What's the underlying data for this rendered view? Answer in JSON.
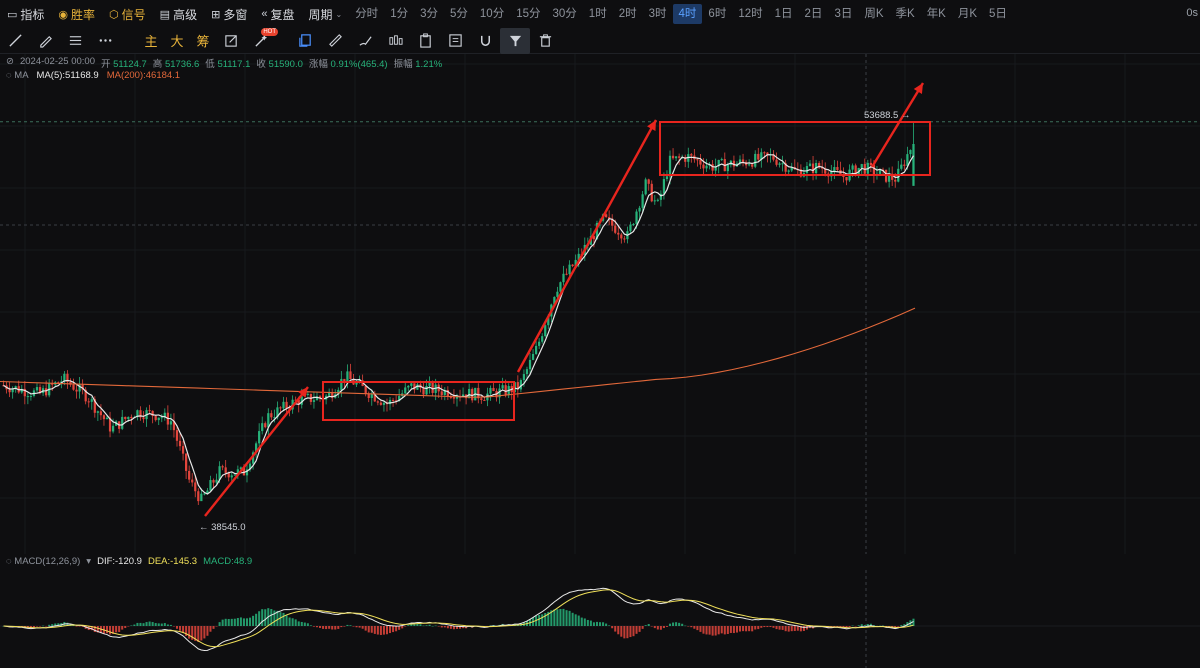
{
  "toolbar": {
    "items": [
      {
        "label": "指标",
        "icon": "indicator-icon",
        "gold": false
      },
      {
        "label": "胜率",
        "icon": "winrate-icon",
        "gold": true
      },
      {
        "label": "信号",
        "icon": "signal-icon",
        "gold": true
      },
      {
        "label": "高级",
        "icon": "advanced-icon",
        "gold": false
      },
      {
        "label": "多窗",
        "icon": "multiwindow-icon",
        "gold": false
      },
      {
        "label": "复盘",
        "icon": "replay-icon",
        "gold": false
      },
      {
        "label": "周期",
        "icon": "chevron-down-icon",
        "gold": false
      }
    ],
    "periods": [
      "分时",
      "1分",
      "3分",
      "5分",
      "10分",
      "15分",
      "30分",
      "1时",
      "2时",
      "3时",
      "4时",
      "6时",
      "12时",
      "1日",
      "2日",
      "3日",
      "周K",
      "季K",
      "年K",
      "月K",
      "5日"
    ],
    "active_period": "4时",
    "right_edge": "0s"
  },
  "drawing_tools": {
    "text_tools": [
      "主",
      "大",
      "筹"
    ],
    "hot_badge": "HOT"
  },
  "ohlc": {
    "date": "2024-02-25 00:00",
    "open_label": "开",
    "open": "51124.7",
    "high_label": "高",
    "high": "51736.6",
    "low_label": "低",
    "low": "51117.1",
    "close_label": "收",
    "close": "51590.0",
    "change_label": "涨幅",
    "change": "0.91%(465.4)",
    "amplitude_label": "振幅",
    "amplitude": "1.21%"
  },
  "ma_legend": {
    "label": "MA",
    "ma5": "MA(5):51168.9",
    "ma200": "MA(200):46184.1"
  },
  "annotations": {
    "high_marker": "53688.5",
    "low_marker": "38545.0"
  },
  "macd_legend": {
    "label": "MACD(12,26,9)",
    "dif": "DIF:-120.9",
    "dea": "DEA:-145.3",
    "macd": "MACD:48.9"
  },
  "colors": {
    "up": "#27b27a",
    "down": "#e2453c",
    "ma5": "#e8e8e8",
    "ma200": "#e2683a",
    "dea": "#f0e05a",
    "annotation": "#e8251e",
    "active_period": "#5aa0ff"
  },
  "chart_data": {
    "type": "candlestick",
    "symbol_interval": "4时",
    "series": [
      {
        "name": "MA(5)",
        "last": 51168.9
      },
      {
        "name": "MA(200)",
        "last": 46184.1
      }
    ],
    "marked_high": 53688.5,
    "marked_low": 38545.0,
    "price_path": [
      {
        "x": 0.0,
        "price": 43150
      },
      {
        "x": 0.03,
        "price": 42800
      },
      {
        "x": 0.05,
        "price": 43400
      },
      {
        "x": 0.07,
        "price": 42700
      },
      {
        "x": 0.09,
        "price": 41400
      },
      {
        "x": 0.11,
        "price": 42100
      },
      {
        "x": 0.13,
        "price": 41950
      },
      {
        "x": 0.14,
        "price": 41700
      },
      {
        "x": 0.155,
        "price": 39300
      },
      {
        "x": 0.165,
        "price": 38545
      },
      {
        "x": 0.18,
        "price": 39700
      },
      {
        "x": 0.2,
        "price": 39650
      },
      {
        "x": 0.22,
        "price": 41900
      },
      {
        "x": 0.245,
        "price": 42550
      },
      {
        "x": 0.27,
        "price": 42700
      },
      {
        "x": 0.285,
        "price": 43500
      },
      {
        "x": 0.3,
        "price": 43000
      },
      {
        "x": 0.32,
        "price": 42400
      },
      {
        "x": 0.34,
        "price": 43100
      },
      {
        "x": 0.37,
        "price": 42900
      },
      {
        "x": 0.4,
        "price": 42750
      },
      {
        "x": 0.42,
        "price": 42950
      },
      {
        "x": 0.43,
        "price": 43100
      },
      {
        "x": 0.445,
        "price": 44700
      },
      {
        "x": 0.46,
        "price": 47000
      },
      {
        "x": 0.48,
        "price": 48300
      },
      {
        "x": 0.5,
        "price": 49800
      },
      {
        "x": 0.52,
        "price": 49100
      },
      {
        "x": 0.535,
        "price": 51200
      },
      {
        "x": 0.545,
        "price": 50300
      },
      {
        "x": 0.555,
        "price": 52100
      },
      {
        "x": 0.57,
        "price": 52300
      },
      {
        "x": 0.59,
        "price": 51900
      },
      {
        "x": 0.615,
        "price": 52050
      },
      {
        "x": 0.64,
        "price": 52300
      },
      {
        "x": 0.66,
        "price": 51700
      },
      {
        "x": 0.68,
        "price": 51900
      },
      {
        "x": 0.7,
        "price": 51500
      },
      {
        "x": 0.715,
        "price": 51900
      },
      {
        "x": 0.735,
        "price": 51500
      },
      {
        "x": 0.75,
        "price": 51350
      },
      {
        "x": 0.77,
        "price": 51600
      },
      {
        "x": 0.79,
        "price": 51800
      },
      {
        "x": 0.755,
        "price": 51300
      },
      {
        "x": 0.76,
        "price": 51590
      }
    ]
  }
}
